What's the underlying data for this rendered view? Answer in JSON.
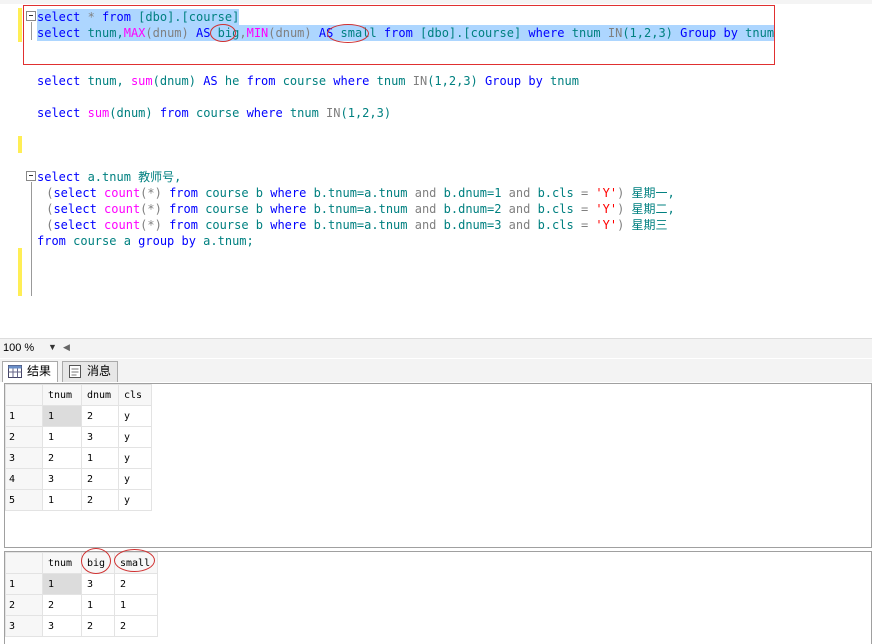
{
  "editor": {
    "lines": {
      "l1": {
        "a": "select",
        "b": " * ",
        "c": "from",
        "d": " [dbo].[course]"
      },
      "l2": {
        "a": "select",
        "b": " tnum,",
        "c": "MAX",
        "d": "(dnum)",
        "e": " AS ",
        "f": "big",
        "g": ",",
        "h": "MIN",
        "i": "(dnum)",
        "j": " AS ",
        "k": "small",
        "l": " from",
        "m": " [dbo].[course] ",
        "n": "where",
        "o": " tnum ",
        "p": "IN",
        "q": "(1,2,3) ",
        "r": "Group by",
        "s": " tnum"
      },
      "l3": {
        "a": "select",
        "b": " tnum, ",
        "c": "sum",
        "d": "(dnum) ",
        "e": "AS",
        "f": " he ",
        "g": "from",
        "h": " course ",
        "i": "where",
        "j": " tnum ",
        "k": "IN",
        "l": "(1,2,3) ",
        "m": "Group by",
        "n": " tnum"
      },
      "l4": {
        "a": "select",
        "b": " ",
        "c": "sum",
        "d": "(dnum) ",
        "e": "from",
        "f": " course ",
        "g": "where",
        "h": " tnum ",
        "i": "IN",
        "j": "(1,2,3)"
      },
      "l5": {
        "a": "select",
        "b": " a.tnum ",
        "c": "教师号,"
      },
      "l6": {
        "a": " (",
        "b": "select",
        "c": " ",
        "d": "count",
        "e": "(*)",
        "f": " from",
        "g": " course b ",
        "h": "where",
        "i": " b.tnum=a.tnum ",
        "j": "and",
        "k": " b.dnum=1 ",
        "l": "and",
        "m": " b.cls ",
        "n": "=",
        "o": " 'Y'",
        "p": ") ",
        "q": "星期一,"
      },
      "l7": {
        "a": " (",
        "b": "select",
        "c": " ",
        "d": "count",
        "e": "(*)",
        "f": " from",
        "g": " course b ",
        "h": "where",
        "i": " b.tnum=a.tnum ",
        "j": "and",
        "k": " b.dnum=2 ",
        "l": "and",
        "m": " b.cls ",
        "n": "=",
        "o": " 'Y'",
        "p": ") ",
        "q": "星期二,"
      },
      "l8": {
        "a": " (",
        "b": "select",
        "c": " ",
        "d": "count",
        "e": "(*)",
        "f": " from",
        "g": " course b ",
        "h": "where",
        "i": " b.tnum=a.tnum ",
        "j": "and",
        "k": " b.dnum=3 ",
        "l": "and",
        "m": " b.cls ",
        "n": "=",
        "o": " 'Y'",
        "p": ") ",
        "q": "星期三"
      },
      "l9": {
        "a": "from",
        "b": " course a ",
        "c": "group by",
        "d": " a.tnum;"
      }
    }
  },
  "zoom": {
    "value": "100 %",
    "dropdown_icon": "dropdown-arrow-icon",
    "scroll_icon": "scroll-left-icon"
  },
  "tabs": {
    "results": {
      "label": "结果",
      "icon": "grid-icon"
    },
    "messages": {
      "label": "消息",
      "icon": "message-icon"
    }
  },
  "grid1": {
    "columns": [
      "tnum",
      "dnum",
      "cls"
    ],
    "rows": [
      {
        "num": "1",
        "c1": "1",
        "c2": "2",
        "c3": "y"
      },
      {
        "num": "2",
        "c1": "1",
        "c2": "3",
        "c3": "y"
      },
      {
        "num": "3",
        "c1": "2",
        "c2": "1",
        "c3": "y"
      },
      {
        "num": "4",
        "c1": "3",
        "c2": "2",
        "c3": "y"
      },
      {
        "num": "5",
        "c1": "1",
        "c2": "2",
        "c3": "y"
      }
    ]
  },
  "grid2": {
    "columns": [
      "tnum",
      "big",
      "small"
    ],
    "rows": [
      {
        "num": "1",
        "c1": "1",
        "c2": "3",
        "c3": "2"
      },
      {
        "num": "2",
        "c1": "2",
        "c2": "1",
        "c3": "1"
      },
      {
        "num": "3",
        "c1": "3",
        "c2": "2",
        "c3": "2"
      }
    ]
  },
  "colors": {
    "keyword": "#0000ff",
    "function": "#ff00ff",
    "operator": "#808080",
    "string": "#ff0000",
    "selection": "#add6ff",
    "annotation": "#e03030"
  }
}
